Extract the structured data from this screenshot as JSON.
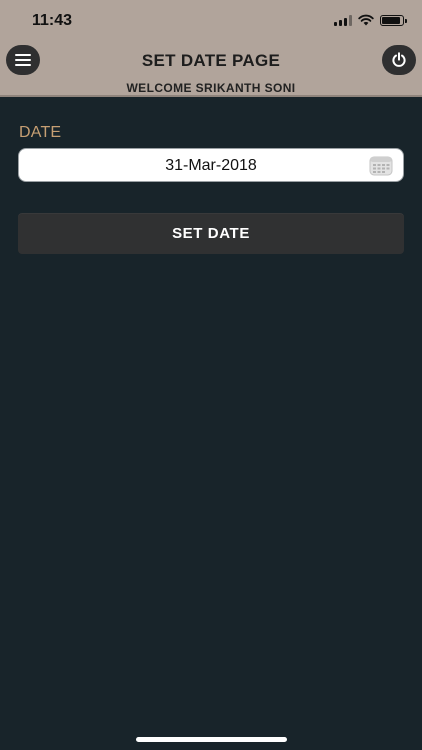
{
  "status_bar": {
    "time": "11:43",
    "signal_icon": "cellular-signal-icon",
    "wifi_icon": "wifi-icon",
    "battery_icon": "battery-icon"
  },
  "header": {
    "title": "SET DATE PAGE",
    "welcome": "WELCOME SRIKANTH SONI",
    "menu_icon": "hamburger-menu-icon",
    "power_icon": "power-icon",
    "background": "#b1a49b"
  },
  "form": {
    "date_label": "DATE",
    "date_value": "31-Mar-2018",
    "calendar_icon": "calendar-icon",
    "label_color": "#c69f73"
  },
  "actions": {
    "set_date_label": "SET DATE"
  },
  "theme": {
    "page_background": "#18242a",
    "button_background": "#303132"
  }
}
